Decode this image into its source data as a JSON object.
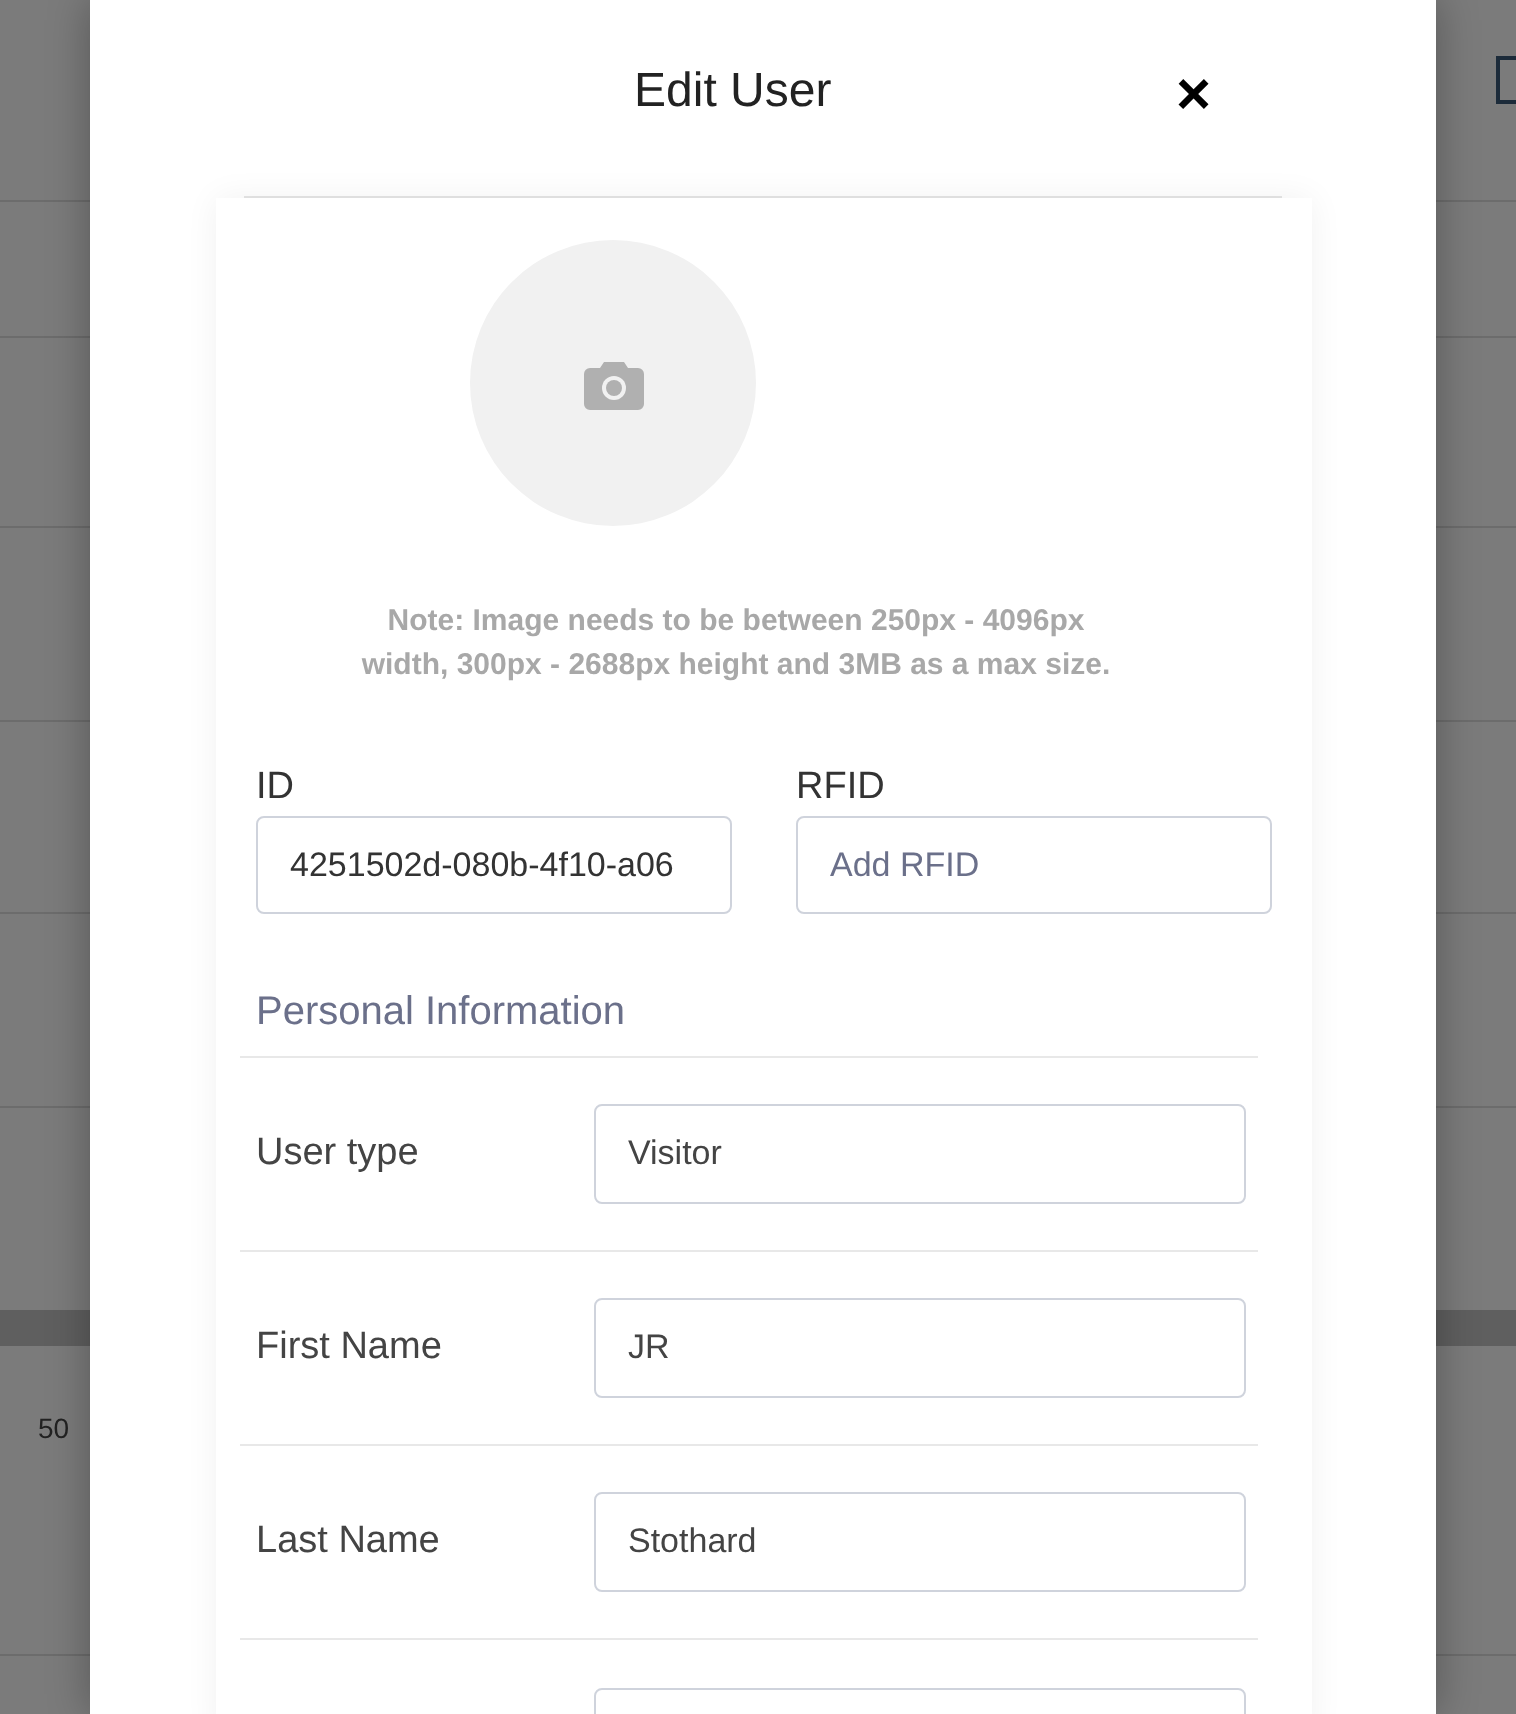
{
  "background": {
    "page_size": "50"
  },
  "dialog": {
    "title": "Edit User",
    "close": "×",
    "note": "Note: Image needs to be between 250px - 4096px width, 300px - 2688px height and 3MB as a max size.",
    "id_field": {
      "label": "ID",
      "value": "4251502d-080b-4f10-a06"
    },
    "rfid_field": {
      "label": "RFID",
      "placeholder": "Add RFID"
    },
    "section_title": "Personal Information",
    "rows": [
      {
        "label": "User type",
        "value": "Visitor"
      },
      {
        "label": "First Name",
        "value": "JR"
      },
      {
        "label": "Last Name",
        "value": "Stothard"
      }
    ]
  }
}
